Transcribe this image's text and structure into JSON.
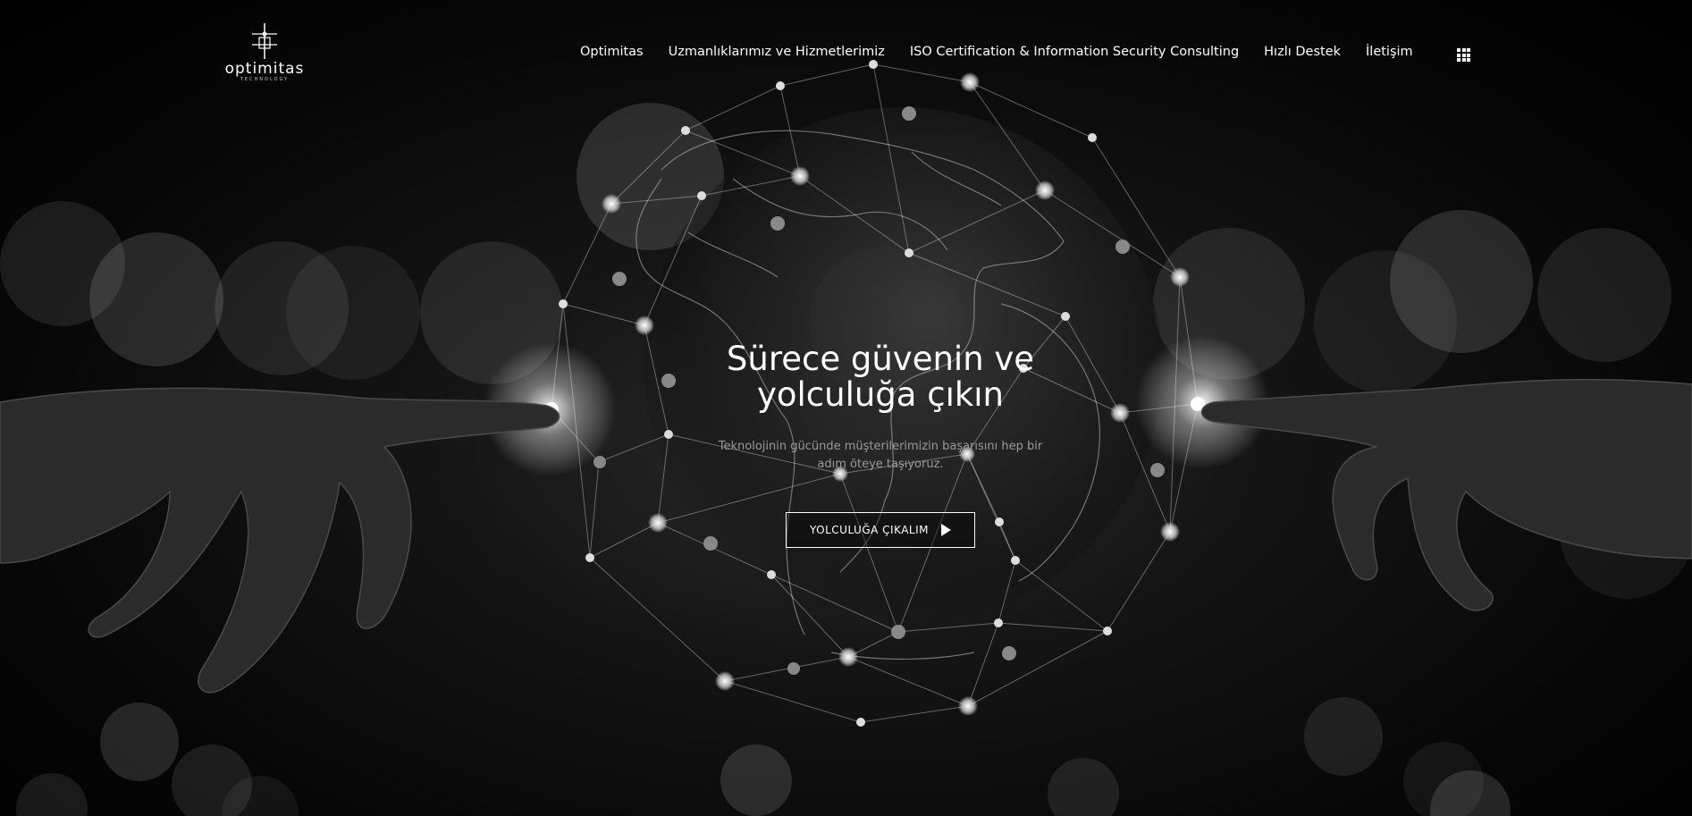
{
  "brand": {
    "name": "optimitas",
    "tagline": "TECHNOLOGY"
  },
  "nav": {
    "items": [
      {
        "label": "Optimitas"
      },
      {
        "label": "Uzmanlıklarımız ve Hizmetlerimiz"
      },
      {
        "label": "ISO Certification & Information Security Consulting"
      },
      {
        "label": "Hızlı Destek"
      },
      {
        "label": "İletişim"
      }
    ],
    "menu_icon": "grid-menu-icon"
  },
  "hero": {
    "title_line1": "Sürece güvenin ve",
    "title_line2": "yolculuğa çıkın",
    "subtitle": "Teknolojinin gücünde müşterilerimizin başarısını hep bir adım öteye taşıyoruz.",
    "cta_label": "YOLCULUĞA ÇIKALIM",
    "cta_icon": "play-icon"
  },
  "colors": {
    "background": "#000000",
    "text": "#ffffff",
    "muted": "#9a9a9a"
  }
}
